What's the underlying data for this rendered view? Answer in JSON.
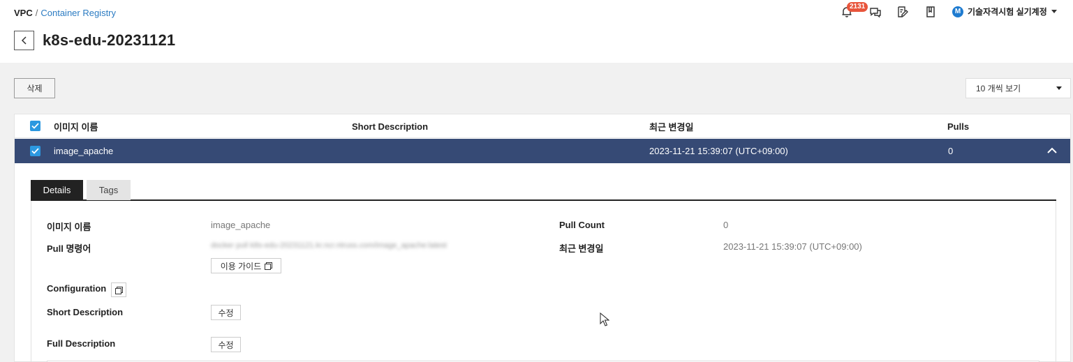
{
  "breadcrumb": {
    "root": "VPC",
    "separator": "/",
    "link": "Container Registry"
  },
  "page_title": "k8s-edu-20231121",
  "header": {
    "notification_count": "2131",
    "account_initial": "M",
    "account_name": "기술자격시험 실기계정"
  },
  "toolbar": {
    "delete_label": "삭제",
    "page_size": "10 개씩 보기"
  },
  "table": {
    "columns": [
      "이미지 이름",
      "Short Description",
      "최근 변경일",
      "Pulls"
    ],
    "rows": [
      {
        "name": "image_apache",
        "short_description": "",
        "modified": "2023-11-21 15:39:07 (UTC+09:00)",
        "pulls": "0"
      }
    ]
  },
  "detail": {
    "tabs": [
      "Details",
      "Tags"
    ],
    "labels": {
      "image_name": "이미지 이름",
      "pull_command": "Pull 명령어",
      "configuration": "Configuration",
      "short_description": "Short Description",
      "full_description": "Full Description",
      "pull_count": "Pull Count",
      "modified": "최근 변경일"
    },
    "values": {
      "image_name": "image_apache",
      "pull_command": "docker pull k8s-edu-20231121.kr.ncr.ntruss.com/image_apache:latest",
      "pull_count": "0",
      "modified": "2023-11-21 15:39:07 (UTC+09:00)"
    },
    "guide_button": "이용 가이드",
    "edit_label": "수정"
  }
}
